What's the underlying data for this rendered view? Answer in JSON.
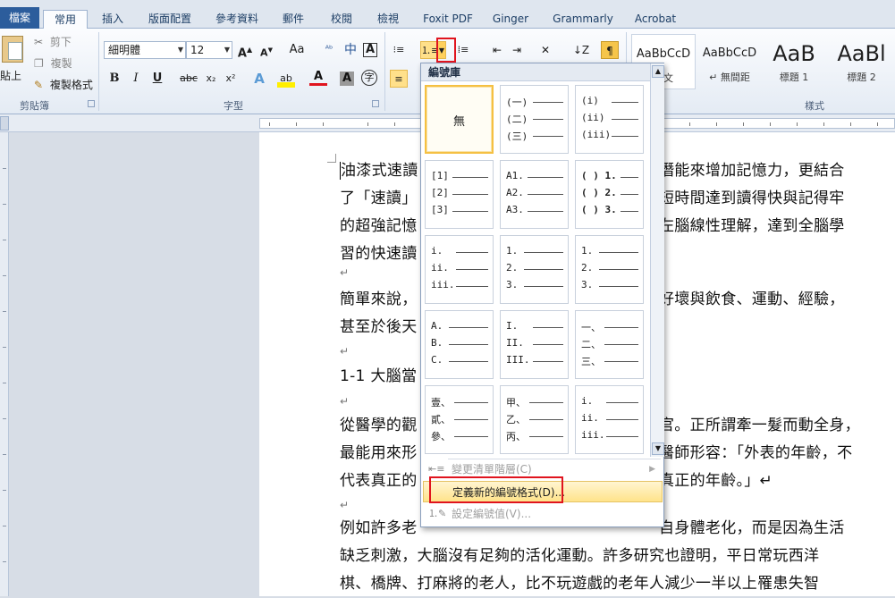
{
  "tabs": [
    {
      "label": "檔案"
    },
    {
      "label": "常用"
    },
    {
      "label": "插入"
    },
    {
      "label": "版面配置"
    },
    {
      "label": "參考資料"
    },
    {
      "label": "郵件"
    },
    {
      "label": "校閱"
    },
    {
      "label": "檢視"
    },
    {
      "label": "Foxit PDF"
    },
    {
      "label": "Ginger"
    },
    {
      "label": "Grammarly"
    },
    {
      "label": "Acrobat"
    }
  ],
  "clipboard": {
    "paste": "貼上",
    "cut": "剪下",
    "copy": "複製",
    "format_painter": "複製格式",
    "group": "剪貼簿"
  },
  "font": {
    "name": "細明體",
    "size": "12",
    "group": "字型",
    "grow": "A",
    "shrink": "A",
    "case": "Aa",
    "bold": "B",
    "italic": "I",
    "underline": "U",
    "strike": "abc",
    "sub": "x₂",
    "sup": "x²",
    "color_a": "A"
  },
  "styles": {
    "group": "樣式",
    "items": [
      {
        "sample": "AaBbCcD",
        "name": "內文"
      },
      {
        "sample": "AaBbCcD",
        "name": "↵ 無間距"
      },
      {
        "sample": "AaB",
        "name": "標題 1"
      },
      {
        "sample": "AaBl",
        "name": "標題 2"
      }
    ]
  },
  "gallery": {
    "header": "編號庫",
    "none_label": "無",
    "cells": [
      [
        "(一)",
        "(二)",
        "(三)"
      ],
      [
        "(i)",
        "(ii)",
        "(iii)"
      ],
      [
        "[1]",
        "[2]",
        "[3]"
      ],
      [
        "A1.",
        "A2.",
        "A3."
      ],
      [
        "( ) 1.",
        "( ) 2.",
        "( ) 3."
      ],
      [
        "i.",
        "ii.",
        "iii."
      ],
      [
        "1.",
        "2.",
        "3."
      ],
      [
        "1.",
        "2.",
        "3."
      ],
      [
        "A.",
        "B.",
        "C."
      ],
      [
        "I.",
        "II.",
        "III."
      ],
      [
        "一、",
        "二、",
        "三、"
      ],
      [
        "壹、",
        "貳、",
        "參、"
      ],
      [
        "甲、",
        "乙、",
        "丙、"
      ],
      [
        "i.",
        "ii.",
        "iii."
      ]
    ],
    "menu": {
      "change_level": "變更清單階層(C)",
      "define_new": "定義新的編號格式(D)...",
      "set_value": "設定編號值(V)..."
    }
  },
  "document": {
    "p1": [
      "油漆式速讀",
      "潛能來增加記憶力，更結合",
      "了「速讀」",
      "短時間達到讀得快與記得牢",
      "的超強記憶",
      "左腦線性理解，達到全腦學",
      "習的快速讀"
    ],
    "p2": [
      "簡單來說，",
      "好壞與飲食、運動、經驗，",
      "甚至於後天"
    ],
    "heading": "1-1 大腦當",
    "p3": [
      "從醫學的觀",
      "官。正所謂牽一髮而動全身，",
      "最能用來形",
      "醫師形容：「外表的年齡，不",
      "代表真正的",
      "真正的年齡。」↵"
    ],
    "p4": [
      "例如許多老",
      "自身體老化，而是因為生活",
      "缺乏刺激，大腦沒有足夠的活化運動。許多研究也證明，平日常玩西洋",
      "棋、橋牌、打麻將的老人，比不玩遊戲的老年人減少一半以上罹患失智"
    ]
  }
}
